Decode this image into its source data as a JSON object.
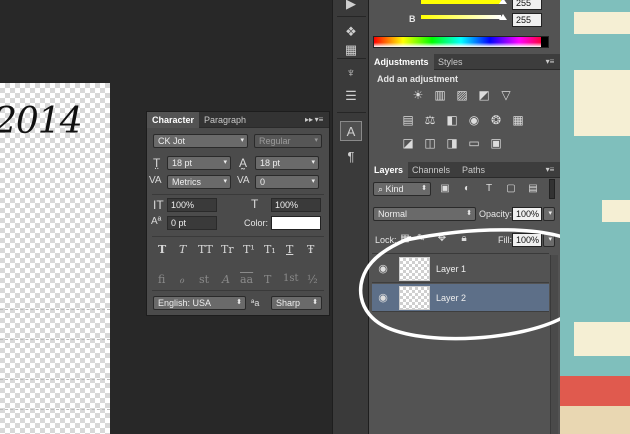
{
  "color_panel": {
    "g_value": "255",
    "b_label": "B",
    "b_value": "255"
  },
  "adjustments": {
    "tabs": [
      "Adjustments",
      "Styles"
    ],
    "heading": "Add an adjustment"
  },
  "character": {
    "tabs": [
      "Character",
      "Paragraph"
    ],
    "font_family": "CK Jot",
    "font_style": "Regular",
    "font_size": "18 pt",
    "leading": "18 pt",
    "kerning": "Metrics",
    "tracking": "0",
    "vertical_scale": "100%",
    "horizontal_scale": "100%",
    "baseline_shift": "0 pt",
    "color_label": "Color:",
    "style_glyphs": [
      "T",
      "T",
      "TT",
      "Tr",
      "T¹",
      "T₁",
      "T",
      "Ŧ"
    ],
    "opentype_glyphs": [
      "fi",
      "ℴ",
      "st",
      "A",
      "aa",
      "T",
      "1st",
      "½"
    ],
    "language": "English: USA",
    "aa_icon_text": "ªa",
    "antialias": "Sharp"
  },
  "layers": {
    "tabs": [
      "Layers",
      "Channels",
      "Paths"
    ],
    "filter_kind": "Kind",
    "blend_mode": "Normal",
    "opacity_label": "Opacity:",
    "opacity": "100%",
    "lock_label": "Lock:",
    "fill_label": "Fill:",
    "fill": "100%",
    "items": [
      {
        "name": "Layer 1",
        "selected": false
      },
      {
        "name": "Layer 2",
        "selected": true
      }
    ]
  },
  "canvas": {
    "text": "2014"
  },
  "colors": {
    "selection_highlight": "#5d6f88",
    "art_teal": "#7fbfbc",
    "art_cream": "#f5efd4",
    "art_red": "#e05a4e"
  },
  "icons": [
    "play-icon",
    "swatches-icon",
    "brush-icon",
    "sliders-icon",
    "character-icon",
    "paragraph-icon",
    "eye-icon",
    "lock-icon",
    "link-icon"
  ]
}
